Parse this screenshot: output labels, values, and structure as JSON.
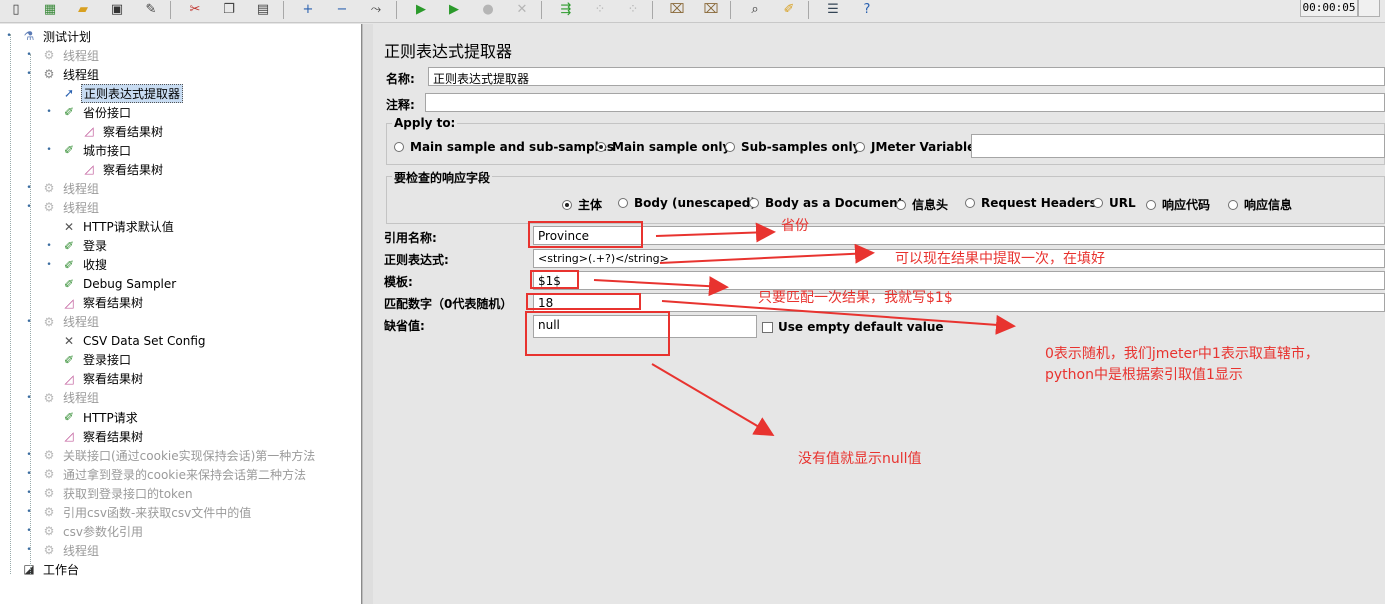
{
  "toolbar": {
    "buttons": [
      {
        "name": "new-icon",
        "glyph": "▯"
      },
      {
        "name": "templates-icon",
        "glyph": "▦"
      },
      {
        "name": "open-icon",
        "glyph": "▰"
      },
      {
        "name": "save-icon",
        "glyph": "▣"
      },
      {
        "name": "save-as-icon",
        "glyph": "✎"
      },
      {
        "name": "cut-icon",
        "glyph": "✂"
      },
      {
        "name": "copy-icon",
        "glyph": "❐"
      },
      {
        "name": "paste-icon",
        "glyph": "▤"
      },
      {
        "name": "expand-icon",
        "glyph": "+"
      },
      {
        "name": "collapse-icon",
        "glyph": "−"
      },
      {
        "name": "toggle-icon",
        "glyph": "⤳"
      },
      {
        "name": "start-icon",
        "glyph": "▶"
      },
      {
        "name": "start-no-pause-icon",
        "glyph": "▶"
      },
      {
        "name": "stop-icon",
        "glyph": "●"
      },
      {
        "name": "shutdown-icon",
        "glyph": "✕"
      },
      {
        "name": "remote-start-icon",
        "glyph": "⇶"
      },
      {
        "name": "remote-stop-icon",
        "glyph": "⁘"
      },
      {
        "name": "remote-shutdown-icon",
        "glyph": "⁘"
      },
      {
        "name": "clear-icon",
        "glyph": "⌧"
      },
      {
        "name": "clear-all-icon",
        "glyph": "⌧"
      },
      {
        "name": "search-icon",
        "glyph": "⌕"
      },
      {
        "name": "reset-search-icon",
        "glyph": "✐"
      },
      {
        "name": "function-helper-icon",
        "glyph": "☰"
      },
      {
        "name": "help-icon",
        "glyph": "?"
      }
    ],
    "timer": "00:00:05"
  },
  "tree": [
    {
      "label": "测试计划",
      "icon": "flask-icon",
      "glyph": "⚗",
      "disabled": false
    },
    {
      "label": "线程组",
      "icon": "gear-icon",
      "glyph": "⚙",
      "disabled": true
    },
    {
      "label": "线程组",
      "icon": "gear-icon",
      "glyph": "⚙",
      "disabled": false
    },
    {
      "label": "正则表达式提取器",
      "icon": "extractor-arrow-icon",
      "glyph": "➚",
      "disabled": false,
      "selected": true
    },
    {
      "label": "省份接口",
      "icon": "sampler-pipette-icon",
      "glyph": "✐",
      "disabled": false
    },
    {
      "label": "察看结果树",
      "icon": "listener-chart-icon",
      "glyph": "◿",
      "disabled": false
    },
    {
      "label": "城市接口",
      "icon": "sampler-pipette-icon",
      "glyph": "✐",
      "disabled": false
    },
    {
      "label": "察看结果树",
      "icon": "listener-chart-icon",
      "glyph": "◿",
      "disabled": false
    },
    {
      "label": "线程组",
      "icon": "gear-icon",
      "glyph": "⚙",
      "disabled": true
    },
    {
      "label": "线程组",
      "icon": "gear-icon",
      "glyph": "⚙",
      "disabled": true
    },
    {
      "label": "HTTP请求默认值",
      "icon": "config-wrench-icon",
      "glyph": "✕",
      "disabled": false
    },
    {
      "label": "登录",
      "icon": "sampler-pipette-icon",
      "glyph": "✐",
      "disabled": false
    },
    {
      "label": "收搜",
      "icon": "sampler-pipette-icon",
      "glyph": "✐",
      "disabled": false
    },
    {
      "label": "Debug Sampler",
      "icon": "sampler-pipette-icon",
      "glyph": "✐",
      "disabled": false
    },
    {
      "label": "察看结果树",
      "icon": "listener-chart-icon",
      "glyph": "◿",
      "disabled": false
    },
    {
      "label": "线程组",
      "icon": "gear-icon",
      "glyph": "⚙",
      "disabled": true
    },
    {
      "label": "CSV Data Set Config",
      "icon": "config-wrench-icon",
      "glyph": "✕",
      "disabled": false
    },
    {
      "label": "登录接口",
      "icon": "sampler-pipette-icon",
      "glyph": "✐",
      "disabled": false
    },
    {
      "label": "察看结果树",
      "icon": "listener-chart-icon",
      "glyph": "◿",
      "disabled": false
    },
    {
      "label": "线程组",
      "icon": "gear-icon",
      "glyph": "⚙",
      "disabled": true
    },
    {
      "label": "HTTP请求",
      "icon": "sampler-pipette-icon",
      "glyph": "✐",
      "disabled": false
    },
    {
      "label": "察看结果树",
      "icon": "listener-chart-icon",
      "glyph": "◿",
      "disabled": false
    },
    {
      "label": "关联接口(通过cookie实现保持会话)第一种方法",
      "icon": "gear-icon",
      "glyph": "⚙",
      "disabled": true
    },
    {
      "label": "通过拿到登录的cookie来保持会话第二种方法",
      "icon": "gear-icon",
      "glyph": "⚙",
      "disabled": true
    },
    {
      "label": "获取到登录接口的token",
      "icon": "gear-icon",
      "glyph": "⚙",
      "disabled": true
    },
    {
      "label": "引用csv函数-来获取csv文件中的值",
      "icon": "gear-icon",
      "glyph": "⚙",
      "disabled": true
    },
    {
      "label": "csv参数化引用",
      "icon": "gear-icon",
      "glyph": "⚙",
      "disabled": true
    },
    {
      "label": "线程组",
      "icon": "gear-icon",
      "glyph": "⚙",
      "disabled": true
    },
    {
      "label": "工作台",
      "icon": "workbench-icon",
      "glyph": "◪",
      "disabled": false
    }
  ],
  "panel": {
    "title": "正则表达式提取器",
    "name_label": "名称:",
    "name_value": "正则表达式提取器",
    "comment_label": "注释:",
    "comment_value": "",
    "apply_to": {
      "title": "Apply to:",
      "options": [
        "Main sample and sub-samples",
        "Main sample only",
        "Sub-samples only",
        "JMeter Variable"
      ],
      "selected": "Main sample only",
      "variable_value": ""
    },
    "field_to_check": {
      "title": "要检查的响应字段",
      "options": [
        "主体",
        "Body (unescaped)",
        "Body as a Document",
        "信息头",
        "Request Headers",
        "URL",
        "响应代码",
        "响应信息"
      ],
      "selected": "主体"
    },
    "refname_label": "引用名称:",
    "refname_value": "Province",
    "regex_label": "正则表达式:",
    "regex_value": "<string>(.+?)</string>",
    "template_label": "模板:",
    "template_value": "$1$",
    "match_label": "匹配数字（0代表随机）",
    "match_value": "18",
    "default_label": "缺省值:",
    "default_value": "null",
    "empty_default_label": "Use empty default value"
  },
  "annotations": {
    "a1": "省份",
    "a2": "可以现在结果中提取一次，在填好",
    "a3": "只要匹配一次结果，我就写$1$",
    "a4_line1": "0表示随机，我们jmeter中1表示取直辖市，",
    "a4_line2": "python中是根据索引取值1显示",
    "a5": "没有值就显示null值",
    "color": "#e8332f"
  }
}
